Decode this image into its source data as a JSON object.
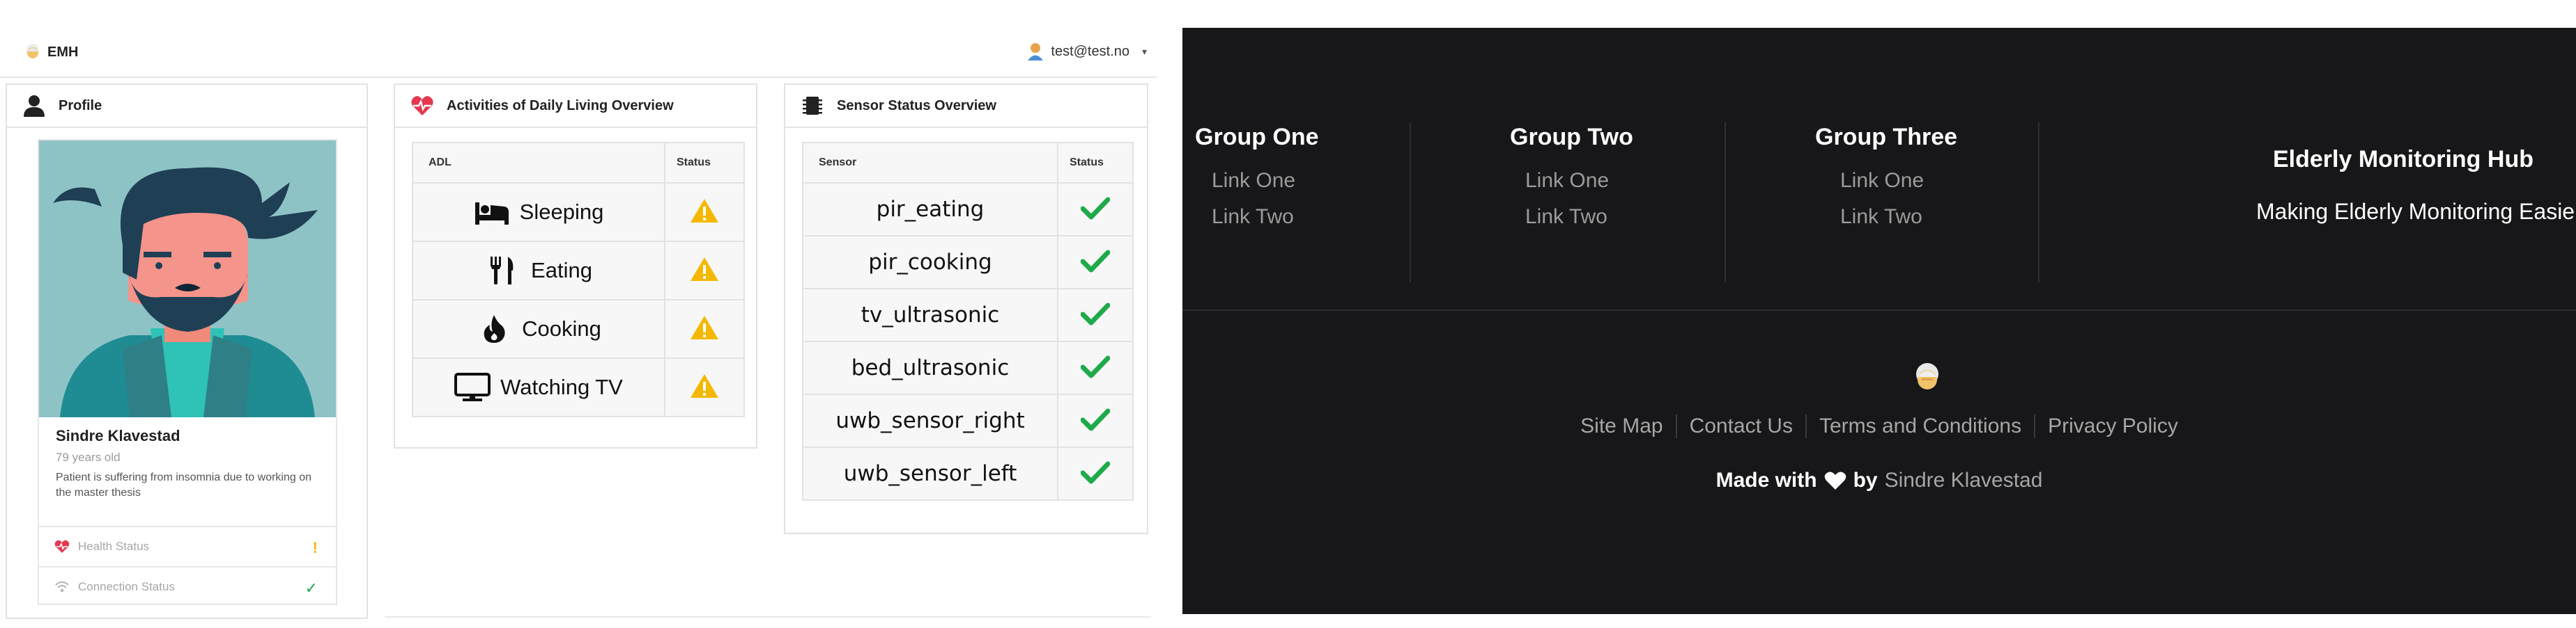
{
  "app": {
    "brand": "EMH",
    "user_email": "test@test.no",
    "user_caret": "▾"
  },
  "profile": {
    "title": "Profile",
    "name": "Sindre Klavestad",
    "age": "79 years old",
    "description": "Patient is suffering from insomnia due to working on the master thesis",
    "health_label": "Health Status",
    "health_value": "!",
    "connection_label": "Connection Status",
    "connection_value": "✓"
  },
  "adl": {
    "title": "Activities of Daily Living Overview",
    "col_adl": "ADL",
    "col_status": "Status",
    "rows": [
      {
        "label": "Sleeping",
        "icon": "bed-icon",
        "status": "warning"
      },
      {
        "label": "Eating",
        "icon": "utensils-icon",
        "status": "warning"
      },
      {
        "label": "Cooking",
        "icon": "fire-icon",
        "status": "warning"
      },
      {
        "label": "Watching TV",
        "icon": "tv-icon",
        "status": "warning"
      }
    ]
  },
  "sensors": {
    "title": "Sensor Status Overview",
    "col_sensor": "Sensor",
    "col_status": "Status",
    "rows": [
      {
        "label": "pir_eating",
        "status": "ok"
      },
      {
        "label": "pir_cooking",
        "status": "ok"
      },
      {
        "label": "tv_ultrasonic",
        "status": "ok"
      },
      {
        "label": "bed_ultrasonic",
        "status": "ok"
      },
      {
        "label": "uwb_sensor_right",
        "status": "ok"
      },
      {
        "label": "uwb_sensor_left",
        "status": "ok"
      }
    ]
  },
  "footer": {
    "groups": [
      {
        "title": "Group One",
        "links": [
          "Link One",
          "Link Two"
        ]
      },
      {
        "title": "Group Two",
        "links": [
          "Link One",
          "Link Two"
        ]
      },
      {
        "title": "Group Three",
        "links": [
          "Link One",
          "Link Two"
        ]
      }
    ],
    "hub_title": "Elderly Monitoring Hub",
    "hub_subtitle": "Making Elderly Monitoring Easier",
    "bottom_links": [
      "Site Map",
      "Contact Us",
      "Terms and Conditions",
      "Privacy Policy"
    ],
    "made_with": "Made with",
    "by": "by",
    "author": "Sindre Klavestad"
  },
  "colors": {
    "warning": "#f5b800",
    "ok": "#1faa4a",
    "heart": "#e53950",
    "footer_bg": "#17171a"
  }
}
